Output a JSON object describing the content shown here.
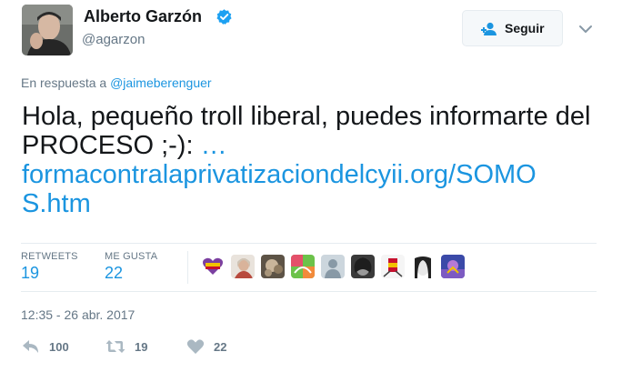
{
  "author": {
    "name": "Alberto Garzón",
    "handle": "@agarzon",
    "verified": true
  },
  "follow_button": {
    "label": "Seguir"
  },
  "reply_context": {
    "prefix": "En respuesta a",
    "mention": "@jaimeberenguer"
  },
  "tweet": {
    "text": "Hola, pequeño troll liberal, puedes informarte del PROCESO ;-): …",
    "text_plain": "Hola, pequeño troll liberal, puedes informarte del PROCESO ;-): ",
    "ellipsis": "…",
    "link_line1": "formacontralaprivatizaciondelcyii.org/SOMO",
    "link_line2": "S.htm"
  },
  "stats": {
    "retweets_label": "RETWEETS",
    "retweets_count": "19",
    "likes_label": "ME GUSTA",
    "likes_count": "22"
  },
  "timestamp": "12:35 - 26 abr. 2017",
  "actions": {
    "reply_count": "100",
    "retweet_count": "19",
    "like_count": "22"
  },
  "colors": {
    "link": "#1b95e0",
    "muted": "#657786",
    "verified": "#1da1f2"
  },
  "icons": [
    "verified-badge-icon",
    "follow-user-icon",
    "chevron-down-icon",
    "reply-icon",
    "retweet-icon",
    "heart-icon"
  ]
}
